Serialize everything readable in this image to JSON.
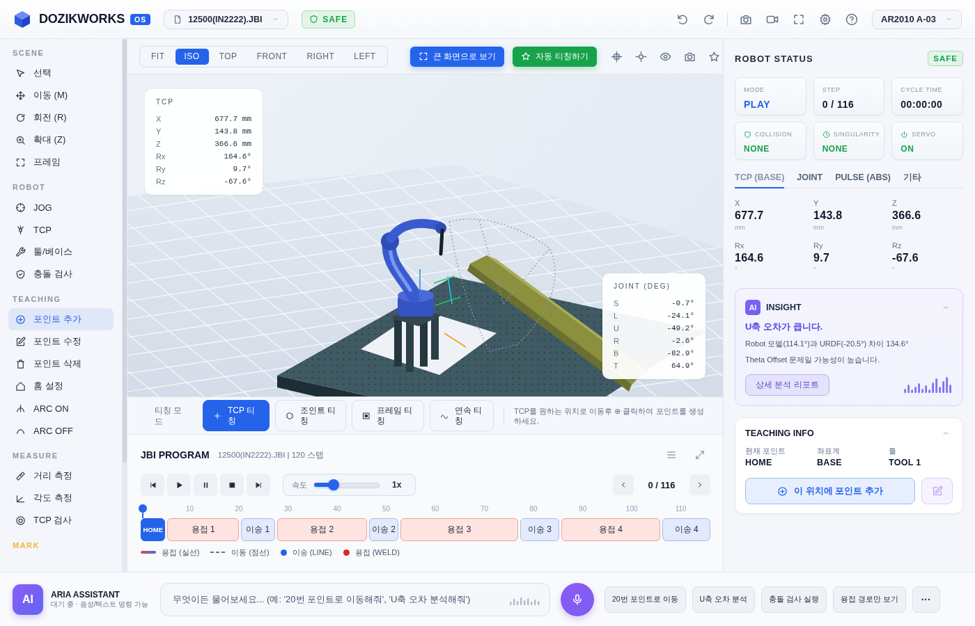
{
  "header": {
    "brand": "DOZIKWORKS",
    "badge": "OS",
    "file": "12500(IN2222).JBI",
    "safety": "SAFE",
    "robot": "AR2010 A-03"
  },
  "sidebar": {
    "sections": [
      {
        "title": "SCENE",
        "highlighted": false,
        "items": [
          {
            "label": "선택",
            "selected": false
          },
          {
            "label": "이동 (M)",
            "selected": false
          },
          {
            "label": "회전 (R)",
            "selected": false
          },
          {
            "label": "확대 (Z)",
            "selected": false
          },
          {
            "label": "프레임",
            "selected": false
          }
        ]
      },
      {
        "title": "ROBOT",
        "highlighted": false,
        "items": [
          {
            "label": "JOG",
            "selected": false
          },
          {
            "label": "TCP",
            "selected": false
          },
          {
            "label": "툴/베이스",
            "selected": false
          },
          {
            "label": "충돌 검사",
            "selected": false
          }
        ]
      },
      {
        "title": "TEACHING",
        "highlighted": false,
        "items": [
          {
            "label": "포인트 추가",
            "selected": true
          },
          {
            "label": "포인트 수정",
            "selected": false
          },
          {
            "label": "포인트 삭제",
            "selected": false
          },
          {
            "label": "홈 설정",
            "selected": false
          },
          {
            "label": "ARC ON",
            "selected": false
          },
          {
            "label": "ARC OFF",
            "selected": false
          }
        ]
      },
      {
        "title": "MEASURE",
        "highlighted": false,
        "items": [
          {
            "label": "거리 측정",
            "selected": false
          },
          {
            "label": "각도 측정",
            "selected": false
          },
          {
            "label": "TCP 검사",
            "selected": false
          }
        ]
      },
      {
        "title": "MARK",
        "highlighted": true
      }
    ]
  },
  "viewport": {
    "views": [
      {
        "label": "FIT",
        "selected": false
      },
      {
        "label": "ISO",
        "selected": true
      },
      {
        "label": "TOP",
        "selected": false
      },
      {
        "label": "FRONT",
        "selected": false
      },
      {
        "label": "RIGHT",
        "selected": false
      },
      {
        "label": "LEFT",
        "selected": false
      }
    ],
    "actions": [
      {
        "label": "큰 화면으로 보기",
        "kind": "primary"
      },
      {
        "label": "자동 티칭하기",
        "kind": "success"
      }
    ],
    "tcp_panel": {
      "title": "TCP",
      "rows": [
        {
          "label": "X",
          "value": "677.7 mm"
        },
        {
          "label": "Y",
          "value": "143.8 mm"
        },
        {
          "label": "Z",
          "value": "366.6 mm"
        },
        {
          "label": "Rx",
          "value": "164.6°"
        },
        {
          "label": "Ry",
          "value": "9.7°"
        },
        {
          "label": "Rz",
          "value": "-67.6°"
        }
      ]
    },
    "joint_panel": {
      "title": "JOINT (DEG)",
      "rows": [
        {
          "label": "S",
          "value": "-0.7°"
        },
        {
          "label": "L",
          "value": "-24.1°"
        },
        {
          "label": "U",
          "value": "-49.2°"
        },
        {
          "label": "R",
          "value": "-2.6°"
        },
        {
          "label": "B",
          "value": "-82.9°"
        },
        {
          "label": "T",
          "value": "64.9°"
        }
      ]
    }
  },
  "teaching_bar": {
    "title": "티칭 모드",
    "modes": [
      {
        "label": "TCP 티칭",
        "selected": true
      },
      {
        "label": "조인트 티칭",
        "selected": false
      },
      {
        "label": "프레임 티칭",
        "selected": false
      },
      {
        "label": "연속 티칭",
        "selected": false
      }
    ],
    "hint": "TCP를 원하는 위치로 이동후 ⊕ 클릭하여 포인트를 생성하세요."
  },
  "program": {
    "title": "JBI PROGRAM",
    "subtitle": "12500(IN2222).JBI | 120 스텝",
    "speed": {
      "label": "속도",
      "level": 0.25,
      "reading": "1x"
    },
    "position": "0 / 116",
    "playhead": {
      "level": 0
    },
    "ticks": [
      "10",
      "20",
      "30",
      "40",
      "50",
      "60",
      "70",
      "80",
      "90",
      "100",
      "110"
    ],
    "segments": [
      {
        "label": "HOME",
        "kind": "home"
      },
      {
        "label": "용접 1",
        "kind": "weld"
      },
      {
        "label": "이송 1",
        "kind": "move"
      },
      {
        "label": "용접 2",
        "kind": "weld"
      },
      {
        "label": "이송 2",
        "kind": "move"
      },
      {
        "label": "용접 3",
        "kind": "weld"
      },
      {
        "label": "이송 3",
        "kind": "move"
      },
      {
        "label": "용접 4",
        "kind": "weld"
      },
      {
        "label": "이송 4",
        "kind": "move"
      }
    ],
    "legend": [
      {
        "label": "용접 (실선)",
        "kind": "gradient-line"
      },
      {
        "label": "이동 (점선)",
        "kind": "dashed-line"
      },
      {
        "label": "이송 (LINE)",
        "kind": "dot",
        "color": "#2563eb"
      },
      {
        "label": "용접 (WELD)",
        "kind": "dot",
        "color": "#dc2626"
      }
    ]
  },
  "robot_status": {
    "title": "ROBOT STATUS",
    "badge": "SAFE",
    "cards": [
      {
        "label": "MODE",
        "value": "PLAY",
        "kind": "accent"
      },
      {
        "label": "STEP",
        "value": "0 / 116",
        "kind": "plain"
      },
      {
        "label": "CYCLE TIME",
        "value": "00:00:00",
        "kind": "plain"
      },
      {
        "label": "COLLISION",
        "value": "NONE",
        "kind": "ok"
      },
      {
        "label": "SINGULARITY",
        "value": "NONE",
        "kind": "ok"
      },
      {
        "label": "SERVO",
        "value": "ON",
        "kind": "ok"
      }
    ],
    "tabs": [
      {
        "label": "TCP (BASE)",
        "selected": true
      },
      {
        "label": "JOINT",
        "selected": false
      },
      {
        "label": "PULSE (ABS)",
        "selected": false
      },
      {
        "label": "기타",
        "selected": false
      }
    ],
    "coordinates": [
      {
        "label": "X",
        "value": "677.7",
        "unit": "mm"
      },
      {
        "label": "Y",
        "value": "143.8",
        "unit": "mm"
      },
      {
        "label": "Z",
        "value": "366.6",
        "unit": "mm"
      },
      {
        "label": "Rx",
        "value": "164.6",
        "unit": "°"
      },
      {
        "label": "Ry",
        "value": "9.7",
        "unit": "°"
      },
      {
        "label": "Rz",
        "value": "-67.6",
        "unit": "°"
      }
    ]
  },
  "insight": {
    "badge": "AI",
    "title": "INSIGHT",
    "headline": "U축 오차가 큽니다.",
    "lines": [
      "Robot 모델(114.1°)과 URDF(-20.5°) 차이 134.6°",
      "Theta Offset 문제일 가능성이 높습니다."
    ],
    "button": "상세 분석 리포트"
  },
  "teaching_info": {
    "title": "TEACHING INFO",
    "fields": [
      {
        "label": "현재 포인트",
        "value": "HOME"
      },
      {
        "label": "좌표계",
        "value": "BASE"
      },
      {
        "label": "툴",
        "value": "TOOL 1"
      }
    ],
    "button": "이 위치에 포인트 추가"
  },
  "assistant": {
    "avatar": "AI",
    "name": "ARIA ASSISTANT",
    "status": "대기 중 · 음성/텍스트 명령 가능",
    "placeholder": "무엇이든 물어보세요... (예: '20번 포인트로 이동해줘', 'U축 오차 분석해줘')",
    "suggestions": [
      "20번 포인트로 이동",
      "U축 오차 분석",
      "충돌 검사 실행",
      "용접 경로만 보기"
    ],
    "more": "···"
  }
}
